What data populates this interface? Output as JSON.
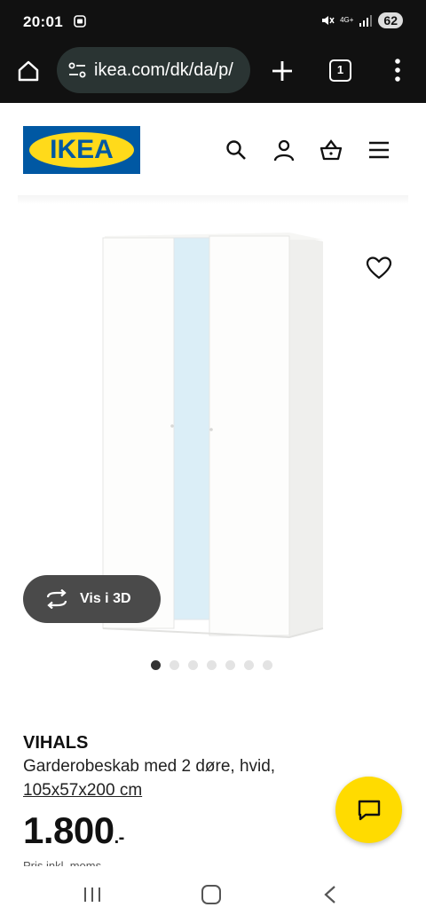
{
  "status_bar": {
    "time": "20:01",
    "network": "4G+",
    "battery": "62"
  },
  "browser": {
    "url": "ikea.com/dk/da/p/",
    "tab_count": "1"
  },
  "header": {
    "logo_text": "IKEA"
  },
  "product_gallery": {
    "view_3d_label": "Vis i 3D",
    "dots_total": 7,
    "active_dot": 0
  },
  "product": {
    "name": "VIHALS",
    "description": "Garderobeskab med 2 døre, hvid,",
    "size": "105x57x200 cm",
    "price": "1.800",
    "price_suffix": ".-",
    "cut_text": "Pris inkl. moms"
  },
  "colors": {
    "ikea_blue": "#0058a3",
    "ikea_yellow": "#ffda1a",
    "chat_yellow": "#ffdb00"
  }
}
